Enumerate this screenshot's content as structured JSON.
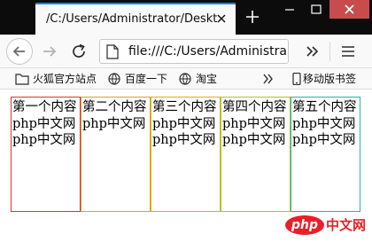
{
  "colors": {
    "tabstrip_bg": "#0c0c0d",
    "accent": "#0a84ff",
    "box_borders": [
      "#d8333b",
      "#e0a021",
      "#d4b30a",
      "#b3c41f",
      "#27b5a0"
    ],
    "watermark": "#e6212a"
  },
  "tab": {
    "title": "/C:/Users/Administrator/Desktop/",
    "close_icon": "close-icon"
  },
  "urlbar": {
    "url": "file:///C:/Users/Administrator/Desktop/"
  },
  "bookmarks": [
    {
      "label": "火狐官方站点",
      "icon": "folder-icon"
    },
    {
      "label": "百度一下",
      "icon": "globe-icon"
    },
    {
      "label": "淘宝",
      "icon": "globe-icon"
    },
    {
      "label": "移动版书签",
      "icon": "mobile-icon"
    }
  ],
  "boxes": [
    {
      "title": "第一个内容",
      "lines": [
        "php中文网",
        "php中文网"
      ]
    },
    {
      "title": "第二个内容",
      "lines": [
        "php中文网"
      ]
    },
    {
      "title": "第三个内容",
      "lines": [
        "php中文网",
        "php中文网"
      ]
    },
    {
      "title": "第四个内容",
      "lines": [
        "php中文网",
        "php中文网"
      ]
    },
    {
      "title": "第五个内容",
      "lines": [
        "php中文网",
        "php中文网"
      ]
    }
  ],
  "watermark": {
    "logo_text": "php",
    "site_text": "中文网"
  }
}
